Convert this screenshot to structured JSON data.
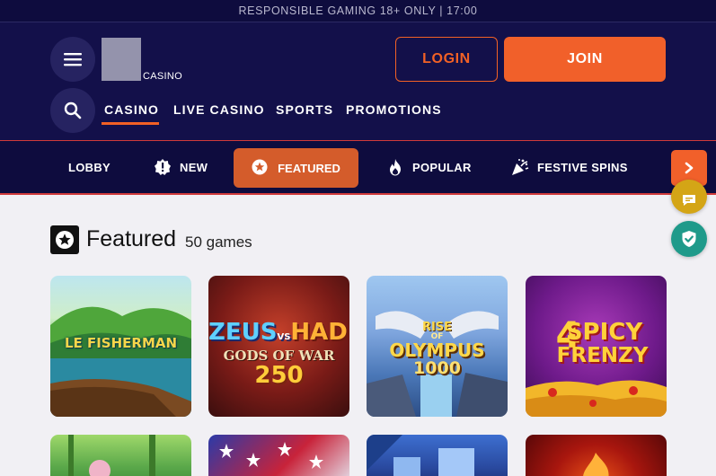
{
  "topbar": {
    "text": "RESPONSIBLE GAMING 18+ ONLY | 17:00"
  },
  "header": {
    "logo_text": "CASINO",
    "login_label": "LOGIN",
    "join_label": "JOIN",
    "nav": [
      "CASINO",
      "LIVE CASINO",
      "SPORTS",
      "PROMOTIONS"
    ],
    "active_nav": "CASINO"
  },
  "categories": {
    "items": [
      {
        "label": "LOBBY",
        "icon": "none"
      },
      {
        "label": "NEW",
        "icon": "badge-exclamation-icon"
      },
      {
        "label": "FEATURED",
        "icon": "star-circle-icon"
      },
      {
        "label": "POPULAR",
        "icon": "flame-icon"
      },
      {
        "label": "FESTIVE SPINS",
        "icon": "party-popper-icon"
      }
    ],
    "active": "FEATURED"
  },
  "section": {
    "title": "Featured",
    "count": "50 games"
  },
  "games": [
    {
      "title": "LE FISHERMAN"
    },
    {
      "title_line1": "ZEUS",
      "title_vs": "VS",
      "title_line2": "HADES",
      "title_line3": "GODS OF WAR",
      "title_line4": "250"
    },
    {
      "title_line1": "RISE",
      "title_line2": "OF",
      "title_line3": "OLYMPUS",
      "title_line4": "1000"
    },
    {
      "title_line1": "4",
      "title_line2": "SPICY",
      "title_line3": "FRENZY"
    }
  ],
  "colors": {
    "navy": "#13104a",
    "accent": "#f1602a",
    "chat": "#d4a516",
    "shield": "#1f9a8a"
  }
}
